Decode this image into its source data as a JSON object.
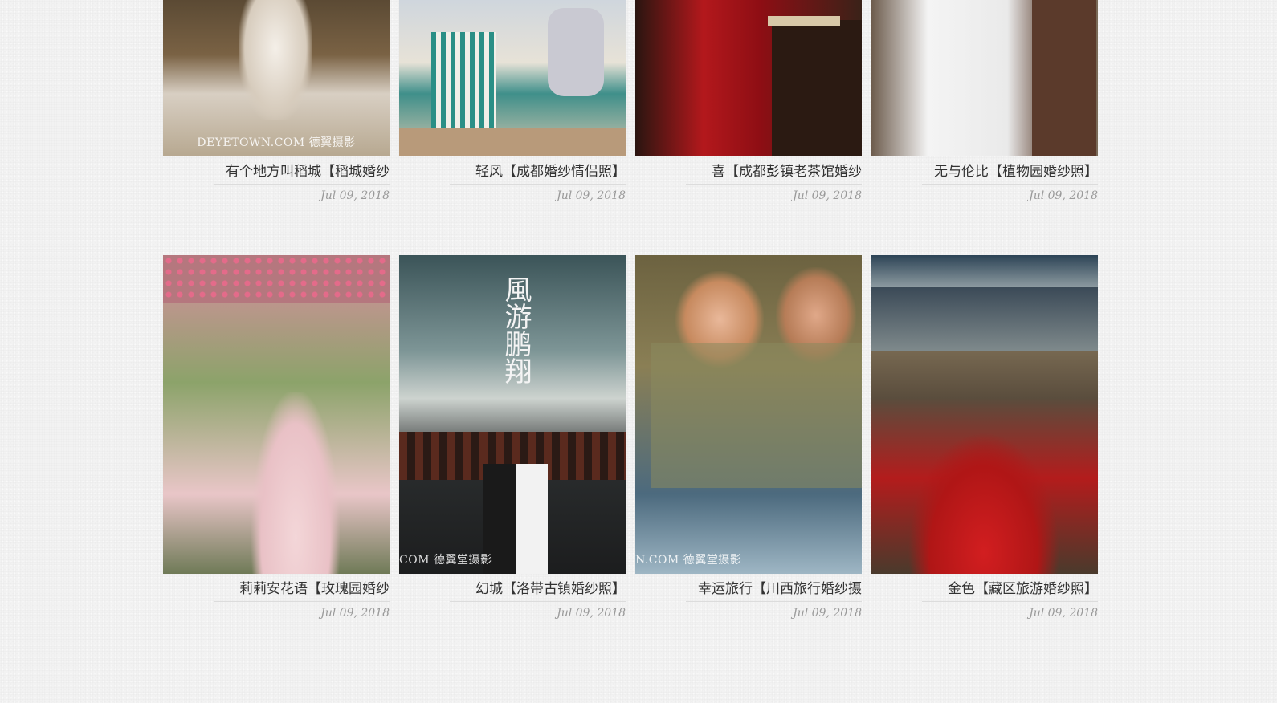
{
  "gallery": {
    "items": [
      {
        "title": "有个地方叫稻城【稻城婚纱",
        "date": "Jul 09, 2018",
        "watermark": "DEYETOWN.COM 德翼摄影"
      },
      {
        "title": "轻风【成都婚纱情侣照】",
        "date": "Jul 09, 2018",
        "watermark": ""
      },
      {
        "title": "喜【成都彭镇老茶馆婚纱",
        "date": "Jul 09, 2018",
        "watermark": ""
      },
      {
        "title": "无与伦比【植物园婚纱照】",
        "date": "Jul 09, 2018",
        "watermark": ""
      },
      {
        "title": "莉莉安花语【玫瑰园婚纱",
        "date": "Jul 09, 2018",
        "watermark": ""
      },
      {
        "title": "幻城【洛带古镇婚纱照】",
        "date": "Jul 09, 2018",
        "watermark": "COM 德翼堂摄影"
      },
      {
        "title": "幸运旅行【川西旅行婚纱摄",
        "date": "Jul 09, 2018",
        "watermark": "N.COM 德翼堂摄影"
      },
      {
        "title": "金色【藏区旅游婚纱照】",
        "date": "Jul 09, 2018",
        "watermark": ""
      }
    ],
    "poster_text": "風游鹏翔"
  },
  "colors": {
    "background": "#f2f2f2",
    "title": "#333333",
    "date": "#9a9a9a",
    "rule": "#dcdcdc"
  }
}
